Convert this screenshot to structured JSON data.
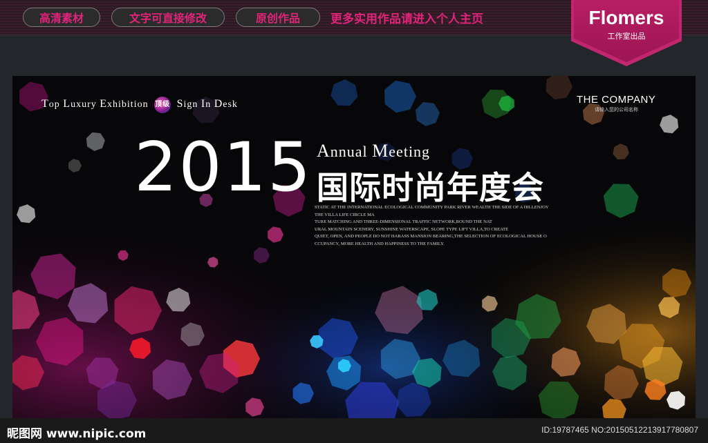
{
  "toolbar": {
    "tags": [
      "高清素材",
      "文字可直接修改",
      "原创作品"
    ],
    "promo": "更多实用作品请进入个人主页"
  },
  "badge": {
    "brand": "Flomers",
    "sub": "工作室出品"
  },
  "poster": {
    "tagline_left": "TOP LUXURY EXHIBITION",
    "seal": "顶级",
    "tagline_right": "SIGN IN DESK",
    "company": "THE COMPANY",
    "company_sub": "请输入您的公司名称",
    "year": "2015",
    "annual": "ANNUAL MEETING",
    "title_cn": "国际时尚年度会",
    "paragraph": [
      "STATIC AT THE INTERNATIONAL ECOLOGICAL COMMUNITY PARK RIVER WEALTH THE SIDE OF A HILLENJOY",
      "THE VILLA LIFE CIRCLE MA",
      "TURE MATCHING AND THREE-DIMENSIONAL TRAFFIC NETWORK,ROUND THE NAT",
      "URAL MOUNTAIN SCENERY, SUNSHINE WATERSCAPE, SLOPE TYPE LIFT VILLA,TO CREATE",
      "QUIET, OPEN, AND PEOPLE DO NOT HARASS MANSION BEARING,THE SELECTION OF ECOLOGICAL HOUSE O",
      "CCUPANCY, MORE HEALTH AND HAPPINESS TO THE FAMILY."
    ]
  },
  "footer": {
    "site_logo": "昵图网 www.nipic.com",
    "image_id": "ID:19787465 NO:20150512213917780807"
  },
  "colors": {
    "accent": "#e0247a",
    "badge": "#b81e64",
    "poster_bg": "#070709"
  }
}
